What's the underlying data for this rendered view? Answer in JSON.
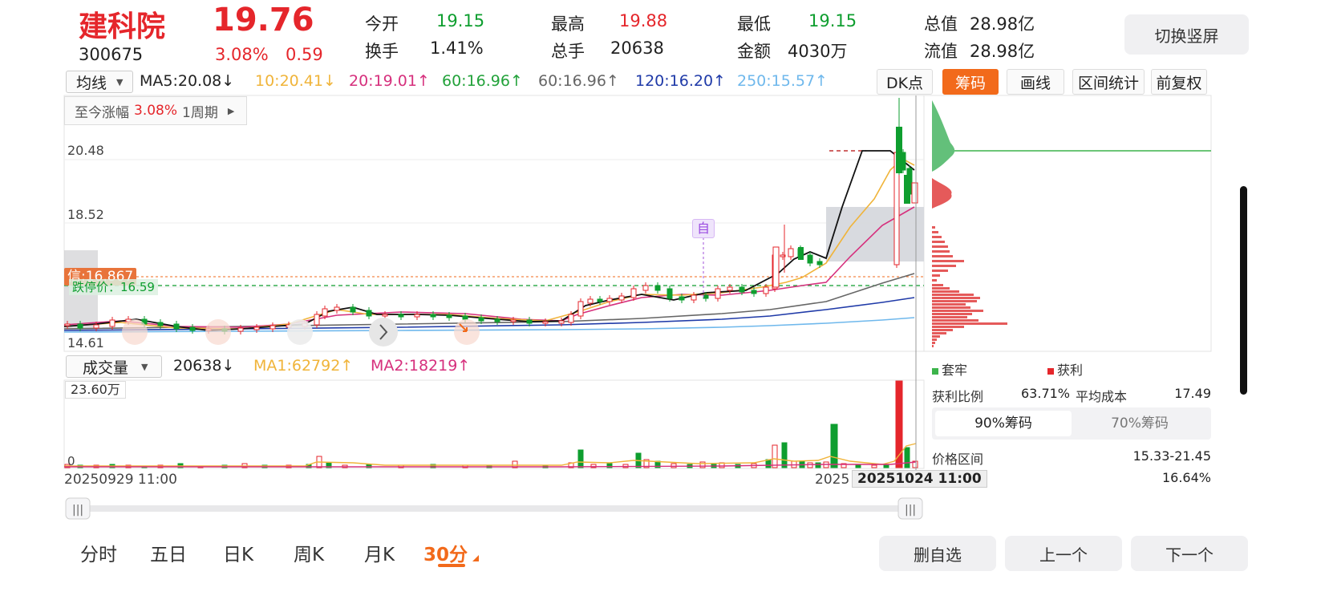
{
  "header": {
    "name": "建科院",
    "code": "300675",
    "price": "19.76",
    "change_pct": "3.08%",
    "change_abs": "0.59",
    "fields": [
      {
        "label": "今开",
        "value": "19.15"
      },
      {
        "label": "最高",
        "value": "19.88"
      },
      {
        "label": "最低",
        "value": "19.15"
      },
      {
        "label": "总值",
        "value": "28.98亿"
      },
      {
        "label": "换手",
        "value": "1.41%"
      },
      {
        "label": "总手",
        "value": "20638"
      },
      {
        "label": "金额",
        "value": "4030万"
      },
      {
        "label": "流值",
        "value": "28.98亿"
      }
    ],
    "toggle_button": "切换竖屏"
  },
  "toolbar": {
    "ma_select": "均线",
    "ma_items": [
      {
        "text": "MA5:20.08↓",
        "color": "#222222"
      },
      {
        "text": "10:20.41↓",
        "color": "#f0b43a"
      },
      {
        "text": "20:19.01↑",
        "color": "#d6307d"
      },
      {
        "text": "60:16.96↑",
        "color": "#22a23a"
      },
      {
        "text": "60:16.96↑",
        "color": "#666666"
      },
      {
        "text": "120:16.20↑",
        "color": "#1f3aa8"
      },
      {
        "text": "250:15.57↑",
        "color": "#6fb8ec"
      }
    ],
    "dk_button": "DK点",
    "chips_button": "筹码",
    "draw_button": "画线",
    "range_button": "区间统计",
    "adjust_button": "前复权"
  },
  "chart": {
    "change_label": "至今涨幅",
    "change_value": "3.08%",
    "period_label": "1周期",
    "y_labels": [
      "20.48",
      "18.52",
      "14.61"
    ],
    "signal_tag": "信:16.867",
    "stop_label": "跌停价：16.59",
    "marker_label": "自",
    "volume_select": "成交量",
    "volume_value": "20638↓",
    "vol_ma1": "MA1:62792↑",
    "vol_ma2": "MA2:18219↑",
    "volume_max": "23.60万",
    "volume_zero": "0",
    "x_start": "20250929 11:00",
    "x_mid": "2025",
    "x_cursor": "20251024 11:00",
    "colors": {
      "up": "#e5262b",
      "down": "#0e9e2f",
      "accent": "#f26a1b"
    }
  },
  "chips": {
    "legend_trapped": "套牢",
    "legend_profit": "获利",
    "profit_ratio_label": "获利比例",
    "profit_ratio_value": "63.71%",
    "avg_cost_label": "平均成本",
    "avg_cost_value": "17.49",
    "tab_90": "90%筹码",
    "tab_70": "70%筹码",
    "range_label": "价格区间",
    "range_value": "15.33-21.45",
    "concentration_value": "16.64%"
  },
  "bottom": {
    "tabs": [
      "分时",
      "五日",
      "日K",
      "周K",
      "月K",
      "30分"
    ],
    "active_tab": "30分",
    "remove_button": "删自选",
    "prev_button": "上一个",
    "next_button": "下一个"
  }
}
